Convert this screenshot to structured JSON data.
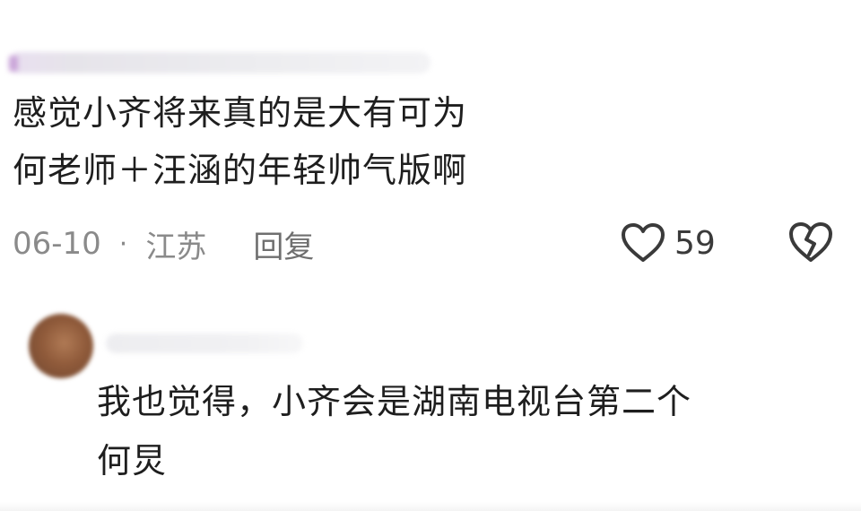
{
  "comment": {
    "lines": [
      "感觉小齐将来真的是大有可为",
      "何老师＋汪涵的年轻帅气版啊"
    ],
    "date": "06-10",
    "separator": "·",
    "location": "江苏",
    "reply_label": "回复",
    "like_count": "59",
    "like_icon": "heart-outline-icon",
    "dislike_icon": "broken-heart-icon"
  },
  "reply_comment": {
    "lines": [
      "我也觉得，小齐会是湖南电视台第二个",
      "何炅"
    ]
  }
}
